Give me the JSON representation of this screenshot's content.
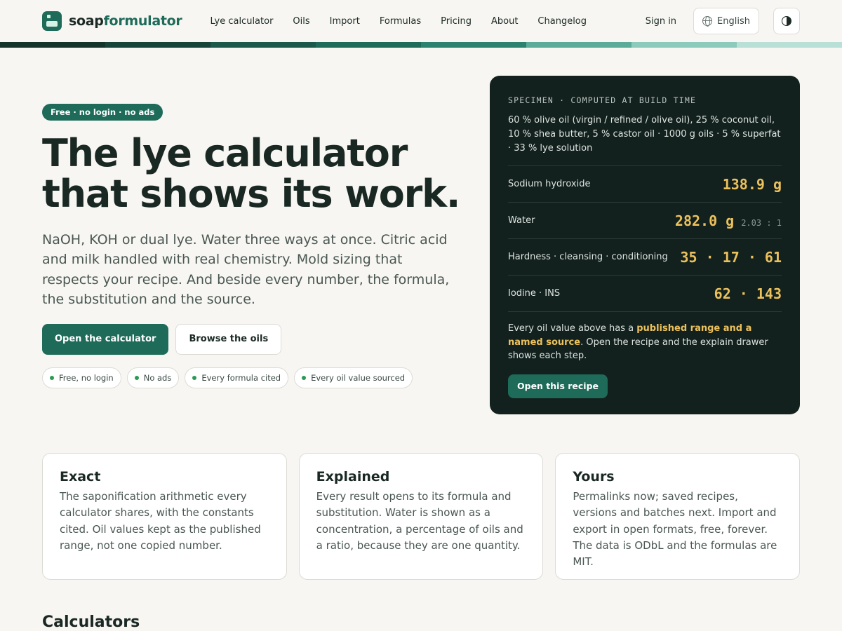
{
  "header": {
    "logo_part1": "soap",
    "logo_part2": "formulator",
    "nav": [
      "Lye calculator",
      "Oils",
      "Import",
      "Formulas",
      "Pricing",
      "About",
      "Changelog"
    ],
    "signin": "Sign in",
    "language": "English"
  },
  "stripe_colors": [
    "#13332b",
    "#174439",
    "#1b5a4b",
    "#1e6b5a",
    "#2a826f",
    "#5aab98",
    "#8ccabb",
    "#b8e0d6"
  ],
  "hero": {
    "pill": "Free · no login · no ads",
    "title": "The lye calculator that shows its work.",
    "subtitle": "NaOH, KOH or dual lye. Water three ways at once. Citric acid and milk handled with real chemistry. Mold sizing that respects your recipe. And beside every number, the formula, the substitution and the source.",
    "cta_primary": "Open the calculator",
    "cta_secondary": "Browse the oils",
    "badges": [
      "Free, no login",
      "No ads",
      "Every formula cited",
      "Every oil value sourced"
    ]
  },
  "specimen": {
    "label": "SPECIMEN · COMPUTED AT BUILD TIME",
    "description": "60 % olive oil (virgin / refined / olive oil), 25 % coconut oil, 10 % shea butter, 5 % castor oil · 1000 g oils · 5 % superfat · 33 % lye solution",
    "rows": [
      {
        "key": "Sodium hydroxide",
        "value": "138.9 g",
        "extra": ""
      },
      {
        "key": "Water",
        "value": "282.0 g",
        "extra": "2.03 : 1"
      },
      {
        "key": "Hardness · cleansing · conditioning",
        "value": "35 · 17 · 61",
        "extra": ""
      },
      {
        "key": "Iodine · INS",
        "value": "62 · 143",
        "extra": ""
      }
    ],
    "note_prefix": "Every oil value above has a ",
    "note_highlight": "published range and a named source",
    "note_suffix": ". Open the recipe and the explain drawer shows each step.",
    "button": "Open this recipe"
  },
  "features": [
    {
      "title": "Exact",
      "body": "The saponification arithmetic every calculator shares, with the constants cited. Oil values kept as the published range, not one copied number."
    },
    {
      "title": "Explained",
      "body": "Every result opens to its formula and substitution. Water is shown as a concentration, a percentage of oils and a ratio, because they are one quantity."
    },
    {
      "title": "Yours",
      "body": "Permalinks now; saved recipes, versions and batches next. Import and export in open formats, free, forever. The data is ODbL and the formulas are MIT."
    }
  ],
  "section_title": "Calculators"
}
